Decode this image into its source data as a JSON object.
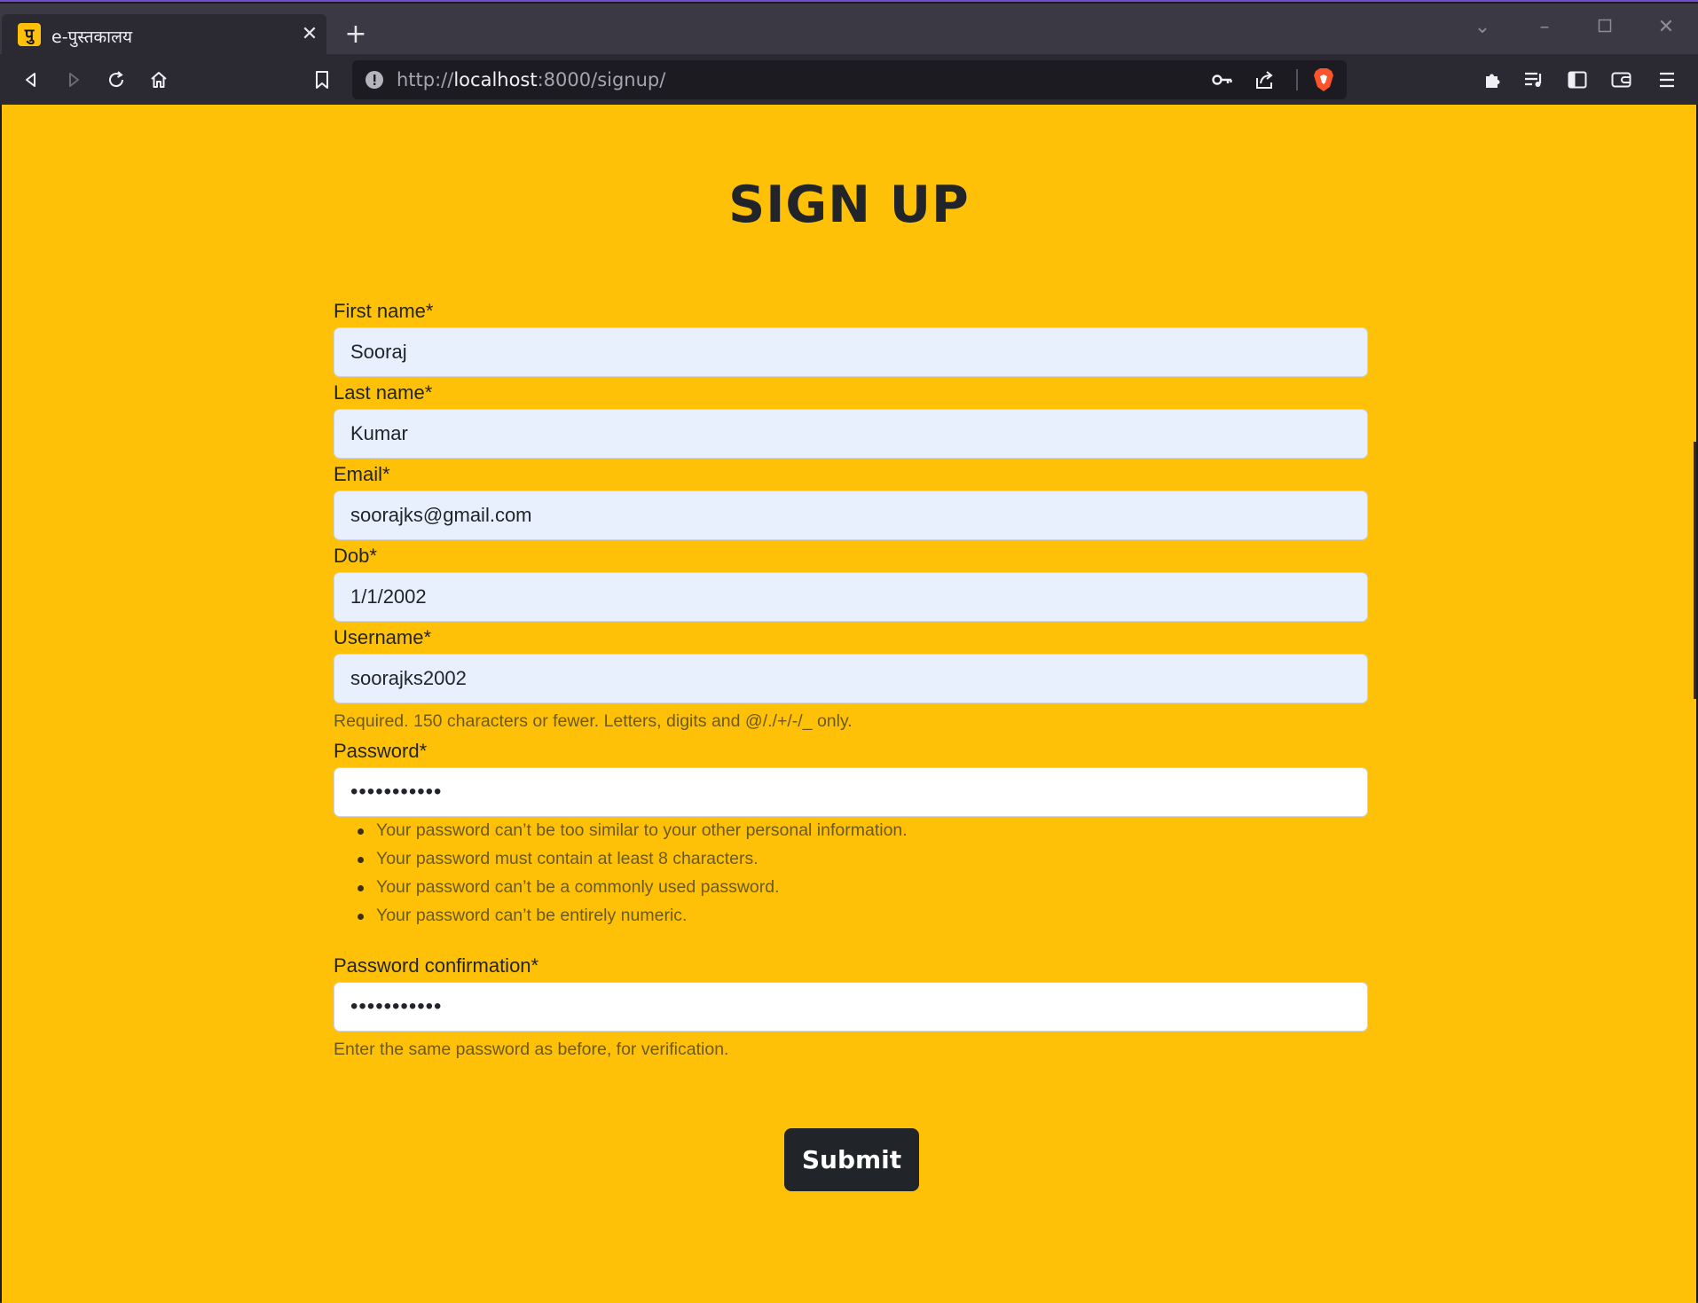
{
  "browser": {
    "tab_title": "e-पुस्तकालय",
    "favicon_letter": "पु",
    "url_scheme": "http://",
    "url_host": "localhost",
    "url_rest": ":8000/signup/"
  },
  "page": {
    "heading": "SIGN UP",
    "background_color": "#ffc107",
    "fields": {
      "first_name": {
        "label": "First name*",
        "value": "Sooraj"
      },
      "last_name": {
        "label": "Last name*",
        "value": "Kumar"
      },
      "email": {
        "label": "Email*",
        "value": "soorajks@gmail.com"
      },
      "dob": {
        "label": "Dob*",
        "value": "1/1/2002"
      },
      "username": {
        "label": "Username*",
        "value": "soorajks2002",
        "help": "Required. 150 characters or fewer. Letters, digits and @/./+/-/_ only."
      },
      "password": {
        "label": "Password*",
        "value": "•••••••••••",
        "help": [
          "Your password can’t be too similar to your other personal information.",
          "Your password must contain at least 8 characters.",
          "Your password can’t be a commonly used password.",
          "Your password can’t be entirely numeric."
        ]
      },
      "password_confirmation": {
        "label": "Password confirmation*",
        "value": "•••••••••••",
        "help": "Enter the same password as before, for verification."
      }
    },
    "submit_label": "Submit"
  }
}
